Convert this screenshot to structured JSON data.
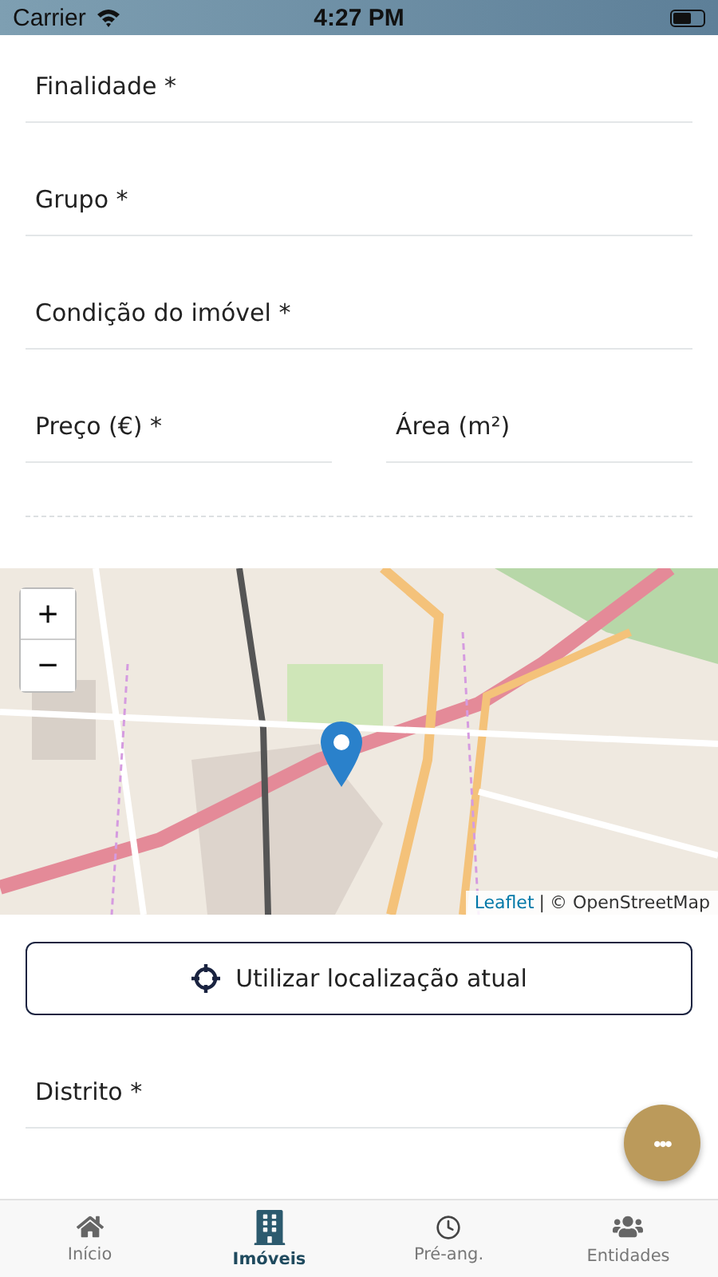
{
  "status_bar": {
    "carrier": "Carrier",
    "time": "4:27 PM"
  },
  "fields": [
    {
      "label": "Finalidade *"
    },
    {
      "label": "Grupo *"
    },
    {
      "label": "Condição do imóvel *"
    }
  ],
  "field_pair": [
    {
      "label": "Preço (€) *"
    },
    {
      "label": "Área (m²)"
    }
  ],
  "map": {
    "zoom_in": "+",
    "zoom_out": "−",
    "attribution_link": "Leaflet",
    "attribution_separator": "|",
    "attribution_text": "© OpenStreetMap"
  },
  "location_button": {
    "label": "Utilizar localização atual"
  },
  "lower_fields": [
    {
      "label": "Distrito *"
    }
  ],
  "fab": {
    "label": "•••"
  },
  "tabs": [
    {
      "label": "Início",
      "kind": "home",
      "selected": false
    },
    {
      "label": "Imóveis",
      "kind": "building",
      "selected": true
    },
    {
      "label": "Pré-ang.",
      "kind": "clock",
      "selected": false
    },
    {
      "label": "Entidades",
      "kind": "users",
      "selected": false
    }
  ]
}
